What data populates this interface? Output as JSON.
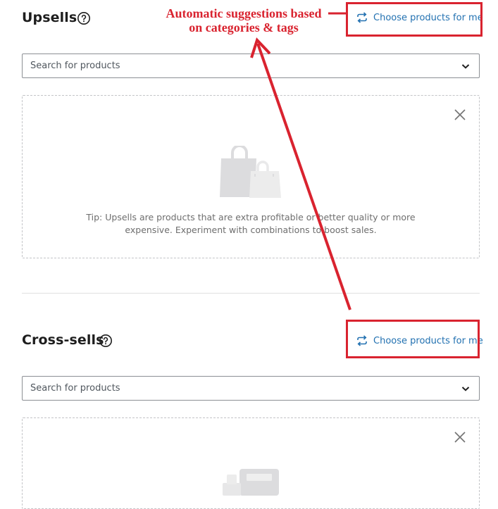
{
  "upsells": {
    "title": "Upsells",
    "choose_label": "Choose products for me",
    "search_placeholder": "Search for products",
    "tip_line1": "Tip: Upsells are products that are extra profitable or better quality or more",
    "tip_line2": "expensive. Experiment with combinations to boost sales."
  },
  "cross_sells": {
    "title": "Cross-sells",
    "choose_label": "Choose products for me",
    "search_placeholder": "Search for products"
  },
  "annotation": {
    "line1": "Automatic suggestions based",
    "line2": "on categories & tags"
  },
  "icons": {
    "help": "help-circle-icon",
    "choose": "repeat-arrows-icon",
    "dropdown": "chevron-down-icon",
    "close": "close-icon",
    "upsells_illustration": "shopping-bags-icon",
    "cross_sells_illustration": "cash-register-icon"
  },
  "colors": {
    "link": "#2271b1",
    "annotation_red": "#d9232f",
    "panel_border": "#c3c4c7",
    "illustration_gray": "#dcdcde"
  }
}
